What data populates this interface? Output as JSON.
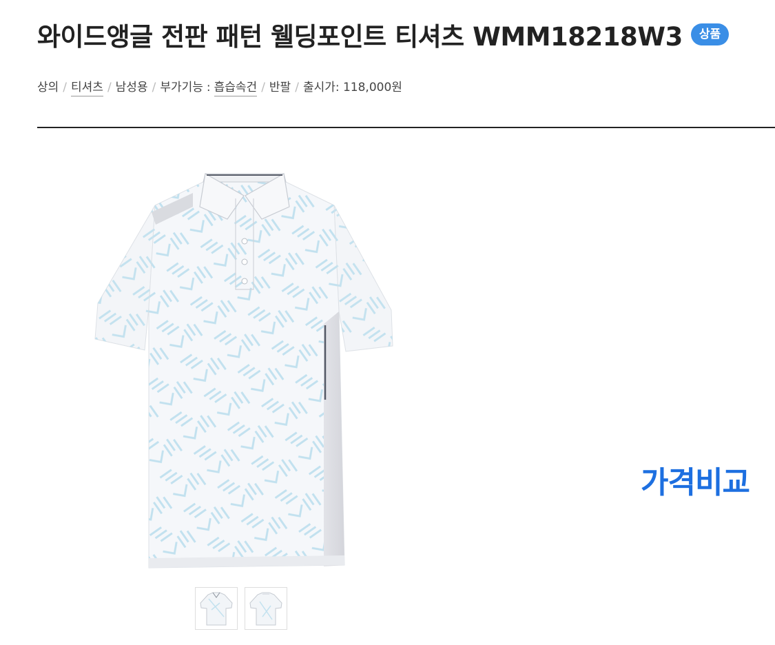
{
  "product": {
    "title": "와이드앵글 전판 패턴 웰딩포인트 티셔츠 WMM18218W3",
    "badge": "상품"
  },
  "specs": {
    "category": "상의",
    "type": "티셔츠",
    "gender": "남성용",
    "feature_label": "부가기능",
    "feature_value": "흡습속건",
    "sleeve": "반팔",
    "release_price": "출시가: 118,000원"
  },
  "gallery": {
    "main_image": "polo-shirt-front",
    "thumbnails": [
      "polo-shirt-front-thumb",
      "polo-shirt-back-thumb"
    ]
  },
  "price_compare": {
    "label": "가격비교"
  },
  "colors": {
    "badge": "#3a8ee6",
    "compare": "#1d6fe0",
    "divider": "#222222"
  }
}
